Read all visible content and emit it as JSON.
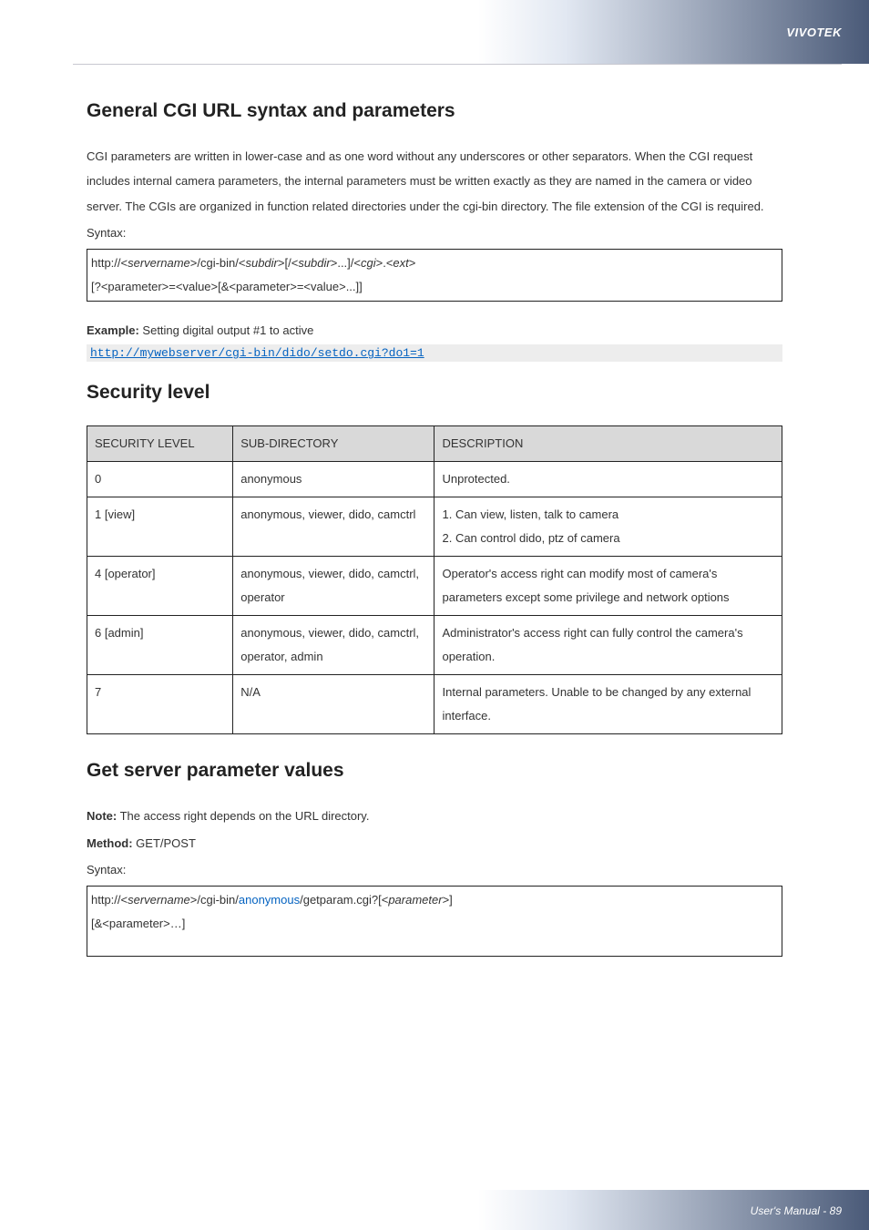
{
  "brand": "VIVOTEK",
  "footer": "User's Manual - 89",
  "s1": {
    "h": "General CGI URL syntax and parameters",
    "p": "CGI parameters are written in lower-case and as one word without any underscores or other separators. When the CGI request includes internal camera parameters, the internal parameters must be written exactly as they are named in the camera or video server. The CGIs are organized in function related directories under the cgi-bin directory. The file extension of the CGI is required.",
    "syntax_label": "Syntax:",
    "syntax_pre": "http://<",
    "syntax_srv": "servername",
    "syntax_mid1": ">/cgi-bin/<",
    "syntax_sub1": "subdir",
    "syntax_mid2": ">[/<",
    "syntax_sub2": "subdir",
    "syntax_mid3": ">...]/<",
    "syntax_cgi": "cgi",
    "syntax_mid4": ">.<",
    "syntax_ext": "ext",
    "syntax_end": ">",
    "syntax_line2": "[?<parameter>=<value>[&<parameter>=<value>...]]",
    "ex_label": "Example:",
    "ex_text": " Setting digital output #1 to active",
    "ex_url": "http://mywebserver/cgi-bin/dido/setdo.cgi?do1=1"
  },
  "s2": {
    "h": "Security level",
    "th1": "SECURITY LEVEL",
    "th2": "SUB-DIRECTORY",
    "th3": "DESCRIPTION",
    "r0c1": "0",
    "r0c2": "anonymous",
    "r0c3": "Unprotected.",
    "r1c1": "1 [view]",
    "r1c2": "anonymous, viewer, dido, camctrl",
    "r1c3a": "1. Can view, listen, talk to camera",
    "r1c3b": "2. Can control dido, ptz of camera",
    "r2c1": "4 [operator]",
    "r2c2": "anonymous, viewer, dido, camctrl, operator",
    "r2c3": "Operator's access right can modify most of camera's parameters except some privilege and network options",
    "r3c1": "6 [admin]",
    "r3c2": "anonymous, viewer, dido, camctrl, operator, admin",
    "r3c3": "Administrator's access right can fully control the camera's operation.",
    "r4c1": "7",
    "r4c2": "N/A",
    "r4c3": "Internal parameters. Unable to be changed by any external interface."
  },
  "s3": {
    "h": "Get server parameter values",
    "note_b": "Note:",
    "note": " The access right depends on the URL directory.",
    "method_b": "Method:",
    "method": " GET/POST",
    "syntax_label": "Syntax:",
    "line1_pre": "http://<",
    "line1_srv": "servername",
    "line1_mid1": ">/cgi-bin/",
    "line1_anon": "anonymous",
    "line1_mid2": "/getparam.cgi?[<",
    "line1_par": "parameter",
    "line1_end": ">]",
    "line2": "[&<parameter>…]"
  }
}
